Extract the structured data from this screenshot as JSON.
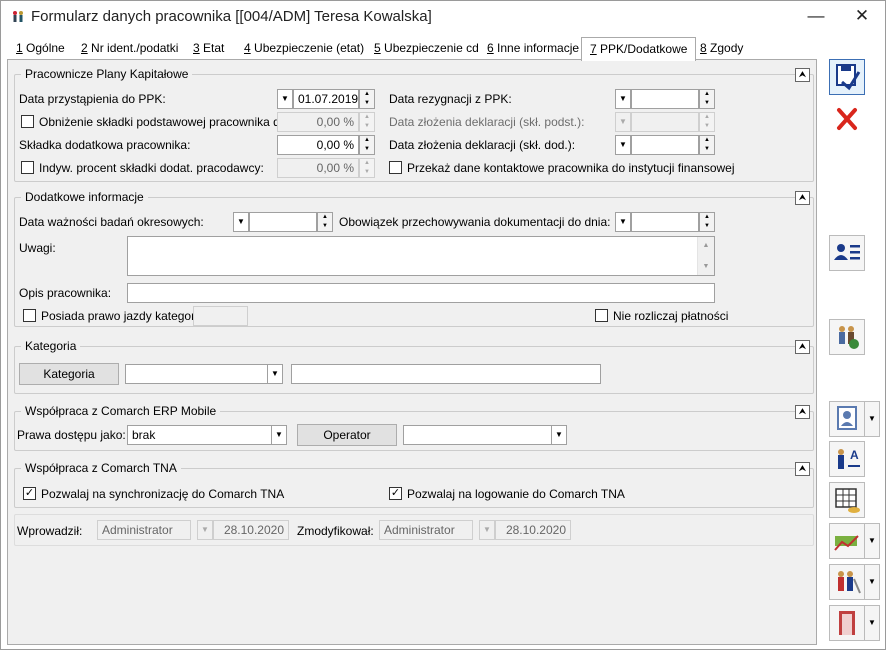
{
  "window": {
    "title": "Formularz danych pracownika [[004/ADM] Teresa Kowalska]"
  },
  "tabs": [
    {
      "num": "1",
      "label": "Ogólne"
    },
    {
      "num": "2",
      "label": "Nr ident./podatki"
    },
    {
      "num": "3",
      "label": "Etat"
    },
    {
      "num": "4",
      "label": "Ubezpieczenie (etat)"
    },
    {
      "num": "5",
      "label": "Ubezpieczenie cd"
    },
    {
      "num": "6",
      "label": "Inne informacje"
    },
    {
      "num": "7",
      "label": "PPK/Dodatkowe"
    },
    {
      "num": "8",
      "label": "Zgody"
    }
  ],
  "ppk": {
    "title": "Pracownicze Plany Kapitałowe",
    "join_label": "Data przystąpienia do PPK:",
    "join_value": "01.07.2019",
    "reduce_label": "Obniżenie składki podstawowej pracownika do:",
    "reduce_value": "0,00 %",
    "extra_label": "Składka dodatkowa pracownika:",
    "extra_value": "0,00 %",
    "indiv_label": "Indyw. procent składki dodat. pracodawcy:",
    "indiv_value": "0,00 %",
    "resign_label": "Data rezygnacji z PPK:",
    "decl_basic_label": "Data złożenia deklaracji (skł. podst.):",
    "decl_extra_label": "Data złożenia deklaracji (skł. dod.):",
    "transfer_label": "Przekaż dane kontaktowe pracownika do instytucji finansowej"
  },
  "extra": {
    "title": "Dodatkowe informacje",
    "exam_label": "Data ważności badań okresowych:",
    "storage_label": "Obowiązek przechowywania dokumentacji do dnia:",
    "notes_label": "Uwagi:",
    "desc_label": "Opis pracownika:",
    "license_label": "Posiada prawo jazdy kategorii:",
    "nosettle_label": "Nie rozliczaj płatności"
  },
  "category": {
    "title": "Kategoria",
    "button": "Kategoria"
  },
  "mobile": {
    "title": "Współpraca z Comarch ERP Mobile",
    "access_label": "Prawa dostępu jako:",
    "access_value": "brak",
    "operator_button": "Operator"
  },
  "tna": {
    "title": "Współpraca z Comarch TNA",
    "sync_label": "Pozwalaj na synchronizację do Comarch TNA",
    "login_label": "Pozwalaj na logowanie do Comarch TNA"
  },
  "footer": {
    "entered_label": "Wprowadził:",
    "entered_user": "Administrator",
    "entered_date": "28.10.2020",
    "modified_label": "Zmodyfikował:",
    "modified_user": "Administrator",
    "modified_date": "28.10.2020"
  },
  "icons": {
    "save": "save-disk-icon",
    "cancel": "red-x-icon",
    "contact": "contact-card-icon",
    "people": "people-icon"
  },
  "colors": {
    "cancel": "#d9261c",
    "save_accent": "#1a3a8a",
    "frame": "#f0f0f0"
  }
}
